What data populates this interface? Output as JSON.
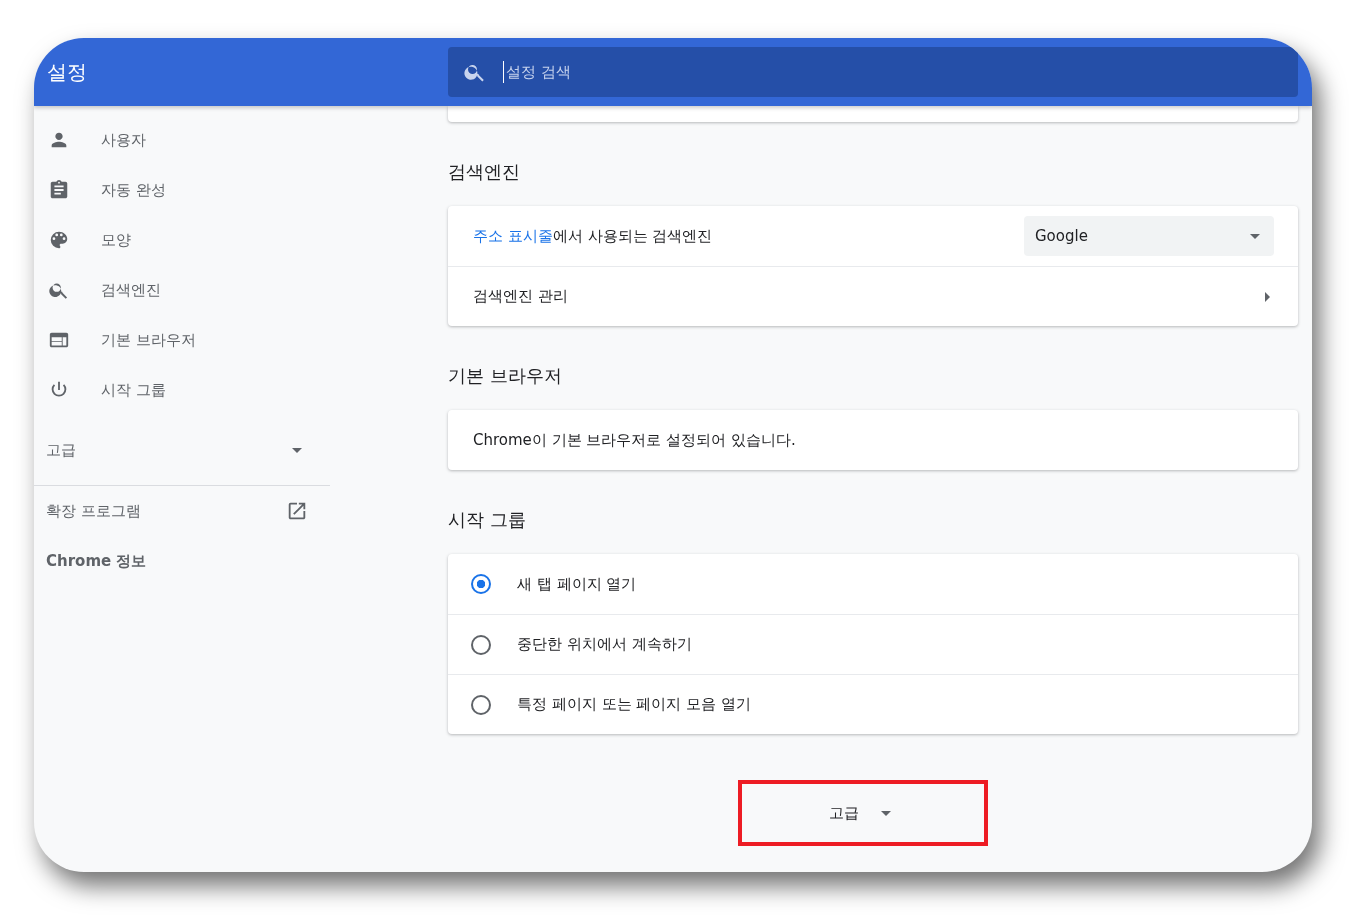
{
  "header": {
    "title": "설정",
    "search": {
      "placeholder": "설정 검색"
    }
  },
  "sidebar": {
    "items": [
      {
        "label": "사용자",
        "selected": false
      },
      {
        "label": "자동 완성",
        "selected": false
      },
      {
        "label": "모양",
        "selected": false
      },
      {
        "label": "검색엔진",
        "selected": false
      },
      {
        "label": "기본 브라우저",
        "selected": false
      },
      {
        "label": "시작 그룹",
        "selected": false
      }
    ],
    "advanced": {
      "label": "고급",
      "expanded": false
    },
    "links": [
      {
        "label": "확장 프로그램",
        "kind": "external"
      },
      {
        "label": "Chrome 정보",
        "kind": "plain"
      }
    ]
  },
  "sections": [
    {
      "title": "검색엔진",
      "rows": [
        {
          "kind": "select",
          "link": "주소 표시줄",
          "label": "에서 사용되는 검색엔진",
          "value": "Google"
        },
        {
          "kind": "link",
          "label": "검색엔진 관리"
        }
      ]
    },
    {
      "title": "기본 브라우저",
      "rows": [
        {
          "kind": "text",
          "label": "Chrome이 기본 브라우저로 설정되어 있습니다."
        }
      ]
    },
    {
      "title": "시작 그룹",
      "rows": [
        {
          "kind": "radio",
          "label": "새 탭 페이지 열기",
          "selected": true
        },
        {
          "kind": "radio",
          "label": "중단한 위치에서 계속하기",
          "selected": false
        },
        {
          "kind": "radio",
          "label": "특정 페이지 또는 페이지 모음 열기",
          "selected": false
        }
      ]
    }
  ],
  "advanced_button": {
    "label": "고급",
    "expanded": false,
    "highlighted": true
  }
}
